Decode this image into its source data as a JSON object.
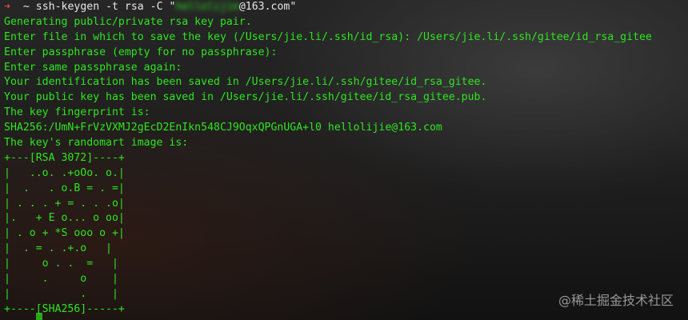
{
  "prompt": {
    "arrow": "➜",
    "dir": "~",
    "command_before": "ssh-keygen -t rsa -C \"",
    "command_blurred": "hellolijie",
    "command_after": "@163.com\""
  },
  "output_lines": [
    "Generating public/private rsa key pair.",
    "Enter file in which to save the key (/Users/jie.li/.ssh/id_rsa): /Users/jie.li/.ssh/gitee/id_rsa_gitee",
    "Enter passphrase (empty for no passphrase):",
    "Enter same passphrase again:",
    "Your identification has been saved in /Users/jie.li/.ssh/gitee/id_rsa_gitee.",
    "Your public key has been saved in /Users/jie.li/.ssh/gitee/id_rsa_gitee.pub.",
    "The key fingerprint is:",
    "SHA256:/UmN+FrVzVXMJ2gEcD2EnIkn548CJ9OqxQPGnUGA+l0 hellolijie@163.com",
    "The key's randomart image is:",
    "+---[RSA 3072]----+",
    "|   ..o. .+oOo. o.|",
    "|  .   . o.B = . =|",
    "| . . . + = . . .o|",
    "|.   + E o... o oo|",
    "| . o + *S ooo o +|",
    "|  . = . .+.o   |",
    "|     o . .  =   |",
    "|     .     o    |",
    "|           .    |",
    "+----[SHA256]-----+"
  ],
  "watermark": "@稀土掘金技术社区",
  "colors": {
    "text": "#2ee61f",
    "arrow": "#e0483e",
    "command": "#e8e8e8",
    "background": "#1b1b1b"
  }
}
